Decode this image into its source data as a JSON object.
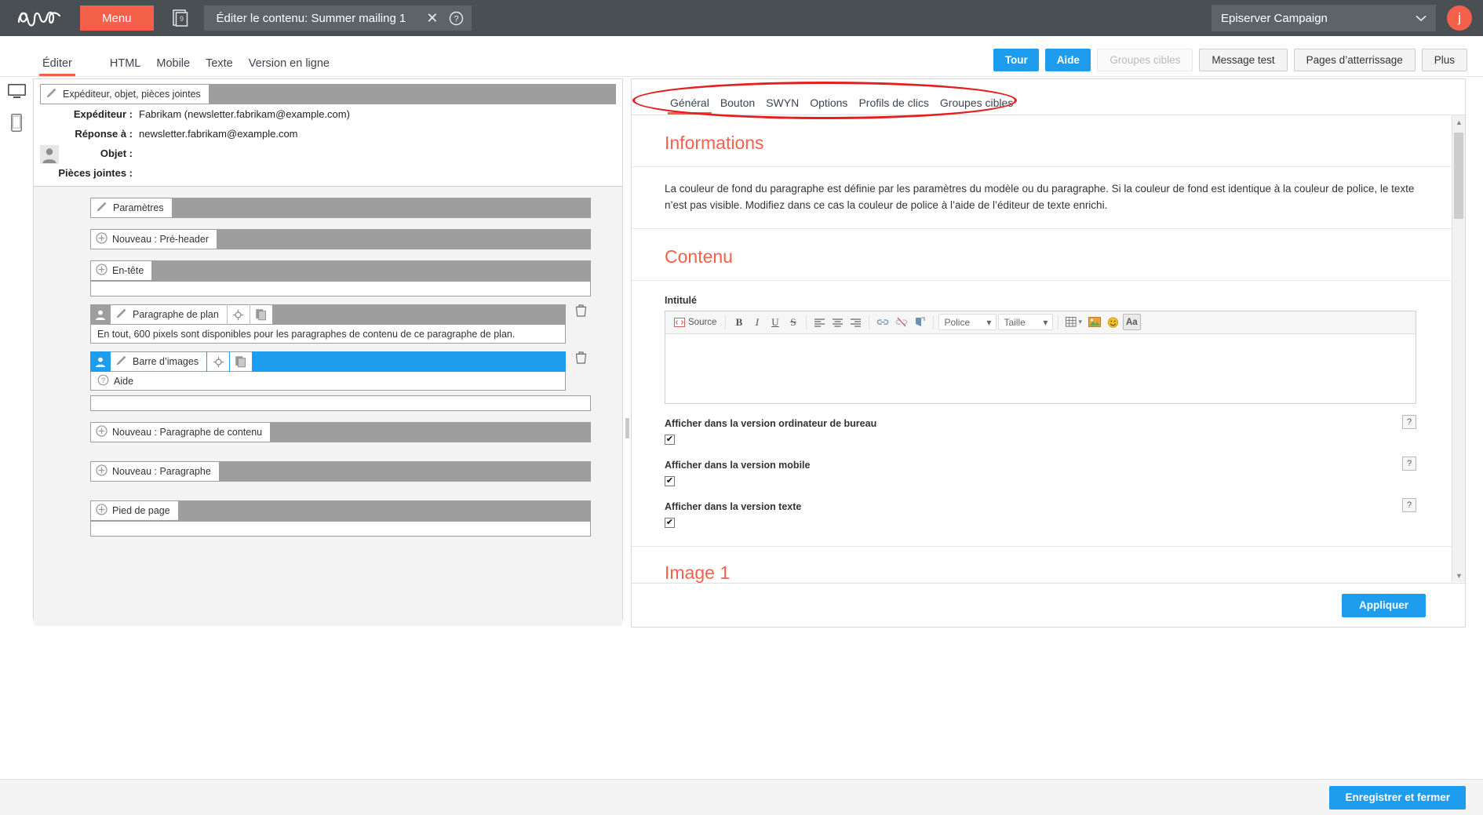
{
  "topbar": {
    "logo_alt": "episerver-logo",
    "menu_label": "Menu",
    "doc_badge": "9",
    "window_title": "Éditer le contenu: Summer mailing 1",
    "close_label": "✕",
    "client_name": "Episerver Campaign",
    "avatar_initial": "j"
  },
  "viewtabs": [
    {
      "label": "Éditer",
      "active": true
    },
    {
      "label": "HTML",
      "active": false
    },
    {
      "label": "Mobile",
      "active": false
    },
    {
      "label": "Texte",
      "active": false
    },
    {
      "label": "Version en ligne",
      "active": false
    }
  ],
  "actions": [
    {
      "label": "Tour",
      "style": "blue"
    },
    {
      "label": "Aide",
      "style": "blue"
    },
    {
      "label": "Groupes cibles",
      "style": "disabled"
    },
    {
      "label": "Message test",
      "style": "normal"
    },
    {
      "label": "Pages d’atterrissage",
      "style": "normal"
    },
    {
      "label": "Plus",
      "style": "normal"
    }
  ],
  "left_panel": {
    "sender_bar_label": "Expéditeur, objet, pièces jointes",
    "fields": [
      {
        "key": "Expéditeur :",
        "value": "Fabrikam (newsletter.fabrikam@example.com)"
      },
      {
        "key": "Réponse à :",
        "value": "newsletter.fabrikam@example.com"
      },
      {
        "key": "Objet :",
        "value": ""
      },
      {
        "key": "Pièces jointes :",
        "value": ""
      }
    ],
    "blocks": [
      {
        "label": "Paramètres",
        "icon": "brush-icon",
        "selected": false
      },
      {
        "label": "Nouveau : Pré-header",
        "icon": "plus-circle-icon",
        "selected": false
      },
      {
        "label": "En-tête",
        "icon": "plus-circle-icon",
        "selected": false
      },
      {
        "label": "Paragraphe de plan",
        "icon": "brush-icon",
        "selected": false,
        "has_person": true,
        "has_tools": true,
        "has_trash": true,
        "note": "En tout, 600 pixels sont disponibles pour les paragraphes de contenu de ce paragraphe de plan."
      },
      {
        "label": "Barre d’images",
        "icon": "brush-icon",
        "selected": true,
        "has_person": true,
        "has_tools": true,
        "has_trash": true,
        "note": "Aide",
        "note_icon": "question-circle-icon"
      },
      {
        "label": "Nouveau : Paragraphe de contenu",
        "icon": "plus-circle-icon",
        "selected": false
      },
      {
        "label": "Nouveau : Paragraphe",
        "icon": "plus-circle-icon",
        "selected": false
      },
      {
        "label": "Pied de page",
        "icon": "plus-circle-icon",
        "selected": false
      }
    ]
  },
  "right_panel": {
    "tabs": [
      {
        "label": "Général",
        "active": true
      },
      {
        "label": "Bouton",
        "active": false
      },
      {
        "label": "SWYN",
        "active": false
      },
      {
        "label": "Options",
        "active": false
      },
      {
        "label": "Profils de clics",
        "active": false
      },
      {
        "label": "Groupes cibles",
        "active": false
      }
    ],
    "information_heading": "Informations",
    "information_text": "La couleur de fond du paragraphe est définie par les paramètres du modèle ou du paragraphe. Si la couleur de fond est identique à la couleur de police, le texte n’est pas visible. Modifiez dans ce cas la couleur de police à l’aide de l’éditeur de texte enrichi.",
    "content_heading": "Contenu",
    "intitule_label": "Intitulé",
    "editor_value": "",
    "toolbar": {
      "source_label": "Source",
      "bold": "B",
      "italic": "I",
      "underline": "U",
      "strike": "S",
      "align_left": "align-left-icon",
      "align_center": "align-center-icon",
      "align_right": "align-right-icon",
      "link": "link-icon",
      "unlink": "unlink-icon",
      "anchor": "anchor-icon",
      "font_label": "Police",
      "size_label": "Taille",
      "table": "table-icon",
      "image": "image-icon",
      "smiley": "smiley-icon",
      "case": "Aa"
    },
    "checkboxes": [
      {
        "label": "Afficher dans la version ordinateur de bureau",
        "checked": true,
        "help": "?"
      },
      {
        "label": "Afficher dans la version mobile",
        "checked": true,
        "help": "?"
      },
      {
        "label": "Afficher dans la version texte",
        "checked": true,
        "help": "?"
      }
    ],
    "image_heading": "Image 1",
    "apply_label": "Appliquer"
  },
  "bottombar": {
    "save_label": "Enregistrer et fermer"
  },
  "colors": {
    "accent_red": "#f4604a",
    "accent_blue": "#1e9ced",
    "dark_header": "#4a4f54",
    "annotation_red": "#e41f1f"
  }
}
